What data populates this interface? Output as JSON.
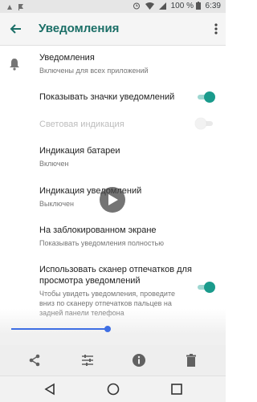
{
  "status": {
    "battery": "100 %",
    "time": "6:39"
  },
  "appbar": {
    "title": "Уведомления"
  },
  "items": [
    {
      "title": "Уведомления",
      "subtitle": "Включены для всех приложений"
    },
    {
      "title": "Показывать значки уведомлений",
      "switch": true
    },
    {
      "title": "Световая индикация",
      "switch": false,
      "disabled": true
    },
    {
      "title": "Индикация батареи",
      "subtitle": "Включен"
    },
    {
      "title": "Индикация уведомлений",
      "subtitle": "Выключен"
    },
    {
      "title": "На заблокированном экране",
      "subtitle": "Показывать уведомления полностью"
    },
    {
      "title": "Использовать сканер отпечатков для просмотра уведомлений",
      "subtitle": "Чтобы увидеть уведомления, проведите вниз по сканеру отпечатков пальцев на задней панели телефона",
      "switch": true
    }
  ],
  "media": {
    "progress": 1.0
  },
  "colors": {
    "accent": "#1a9b8c",
    "title": "#1b6f67",
    "slider": "#3f6fe4"
  },
  "icons": [
    "back-arrow-icon",
    "more-vert-icon",
    "bell-icon",
    "play-icon",
    "share-icon",
    "tune-icon",
    "info-icon",
    "delete-icon",
    "nav-back-icon",
    "nav-home-icon",
    "nav-recents-icon"
  ]
}
